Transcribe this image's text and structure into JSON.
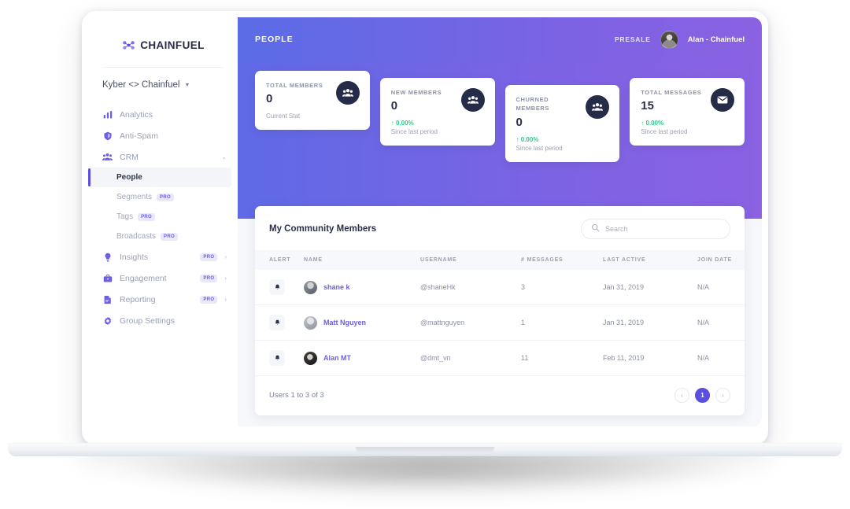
{
  "brand": {
    "name": "CHAINFUEL",
    "logo_icon": "chainfuel-molecule-icon",
    "accent": "#5a4fe0"
  },
  "sidebar": {
    "workspace": {
      "label": "Kyber <> Chainfuel",
      "caret_icon": "chevron-down-icon"
    },
    "items": [
      {
        "label": "Analytics",
        "icon": "bar-chart-icon",
        "badge": "",
        "chevron": ""
      },
      {
        "label": "Anti-Spam",
        "icon": "shield-icon",
        "badge": "",
        "chevron": ""
      },
      {
        "label": "CRM",
        "icon": "people-icon",
        "badge": "",
        "chevron": "chevron-down-icon"
      },
      {
        "label": "Insights",
        "icon": "lightbulb-icon",
        "badge": "PRO",
        "chevron": "chevron-right-icon"
      },
      {
        "label": "Engagement",
        "icon": "briefcase-icon",
        "badge": "PRO",
        "chevron": "chevron-right-icon"
      },
      {
        "label": "Reporting",
        "icon": "document-icon",
        "badge": "PRO",
        "chevron": "chevron-right-icon"
      },
      {
        "label": "Group Settings",
        "icon": "gear-icon",
        "badge": "",
        "chevron": ""
      }
    ],
    "crm_children": [
      {
        "label": "People",
        "badge": "",
        "active": true
      },
      {
        "label": "Segments",
        "badge": "PRO",
        "active": false
      },
      {
        "label": "Tags",
        "badge": "PRO",
        "active": false
      },
      {
        "label": "Broadcasts",
        "badge": "PRO",
        "active": false
      }
    ]
  },
  "topbar": {
    "title": "PEOPLE",
    "plan": "PRESALE",
    "user_name": "Alan - Chainfuel",
    "avatar_icon": "user-avatar",
    "gradient_from": "#5b6ce6",
    "gradient_to": "#8a62e2"
  },
  "stats": [
    {
      "label": "TOTAL MEMBERS",
      "value": "0",
      "delta": "",
      "sub": "Current Stat",
      "icon": "people-icon"
    },
    {
      "label": "NEW MEMBERS",
      "value": "0",
      "delta": "0.00%",
      "sub": "Since last period",
      "icon": "people-icon"
    },
    {
      "label": "CHURNED MEMBERS",
      "value": "0",
      "delta": "0.00%",
      "sub": "Since last period",
      "icon": "people-icon"
    },
    {
      "label": "TOTAL MESSAGES",
      "value": "15",
      "delta": "0.00%",
      "sub": "Since last period",
      "icon": "envelope-icon"
    }
  ],
  "table": {
    "title": "My Community Members",
    "search": {
      "placeholder": "Search",
      "icon": "search-icon"
    },
    "columns": [
      "ALERT",
      "NAME",
      "USERNAME",
      "# MESSAGES",
      "LAST ACTIVE",
      "JOIN DATE"
    ],
    "rows": [
      {
        "alert_icon": "bell-icon",
        "name": "shane k",
        "username": "@shaneHk",
        "messages": "3",
        "last_active": "Jan 31, 2019",
        "join_date": "N/A"
      },
      {
        "alert_icon": "bell-icon",
        "name": "Matt Nguyen",
        "username": "@mattnguyen",
        "messages": "1",
        "last_active": "Jan 31, 2019",
        "join_date": "N/A"
      },
      {
        "alert_icon": "bell-icon",
        "name": "Alan MT",
        "username": "@dmt_vn",
        "messages": "11",
        "last_active": "Feb 11, 2019",
        "join_date": "N/A"
      }
    ],
    "footer_text": "Users 1 to 3 of 3",
    "pagination": {
      "prev_icon": "chevron-left-icon",
      "next_icon": "chevron-right-icon",
      "current_page": "1"
    }
  }
}
